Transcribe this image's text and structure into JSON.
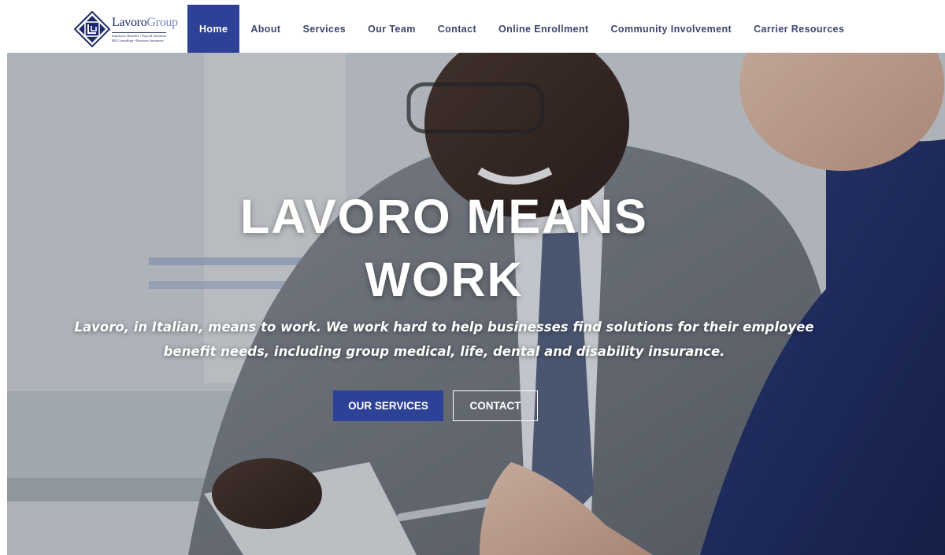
{
  "header": {
    "logo": {
      "word_primary": "Lavoro",
      "word_secondary": "Group",
      "tagline_line1": "Employee Benefits • Payroll Solutions",
      "tagline_line2": "HR Consulting • Business Insurance"
    },
    "nav": [
      {
        "label": "Home",
        "active": true
      },
      {
        "label": "About",
        "active": false
      },
      {
        "label": "Services",
        "active": false
      },
      {
        "label": "Our Team",
        "active": false
      },
      {
        "label": "Contact",
        "active": false
      },
      {
        "label": "Online Enrollment",
        "active": false
      },
      {
        "label": "Community Involvement",
        "active": false
      },
      {
        "label": "Carrier Resources",
        "active": false
      }
    ]
  },
  "hero": {
    "title_line1": "LAVORO MEANS",
    "title_line2": "WORK",
    "subtitle": "Lavoro, in Italian, means to work. We work hard to help businesses find solutions for their employee benefit needs, including group medical, life, dental and disability insurance.",
    "primary_button": "OUR SERVICES",
    "secondary_button": "CONTACT"
  },
  "colors": {
    "accent": "#2d4296",
    "nav_text": "#3d4670",
    "logo_navy": "#1d2a6b",
    "hero_text": "#ffffff"
  }
}
